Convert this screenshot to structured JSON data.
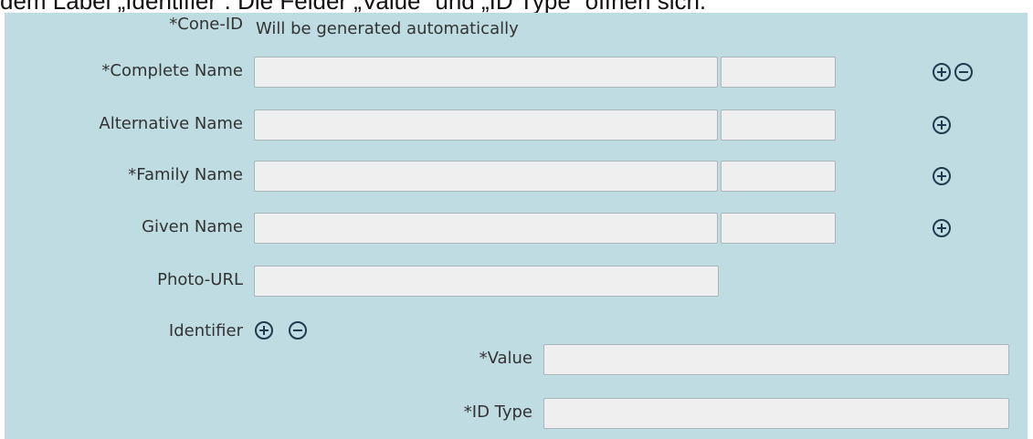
{
  "caption": "dem Label „Identifier“. Die Felder „Value“ und „ID Type“ öffnen sich.",
  "form": {
    "cone_id": {
      "label": "*Cone-ID",
      "value": "Will be generated automatically"
    },
    "complete_name": {
      "label": "*Complete Name",
      "value": "",
      "type_value": ""
    },
    "alternative_name": {
      "label": "Alternative Name",
      "value": "",
      "type_value": ""
    },
    "family_name": {
      "label": "*Family Name",
      "value": "",
      "type_value": ""
    },
    "given_name": {
      "label": "Given Name",
      "value": "",
      "type_value": ""
    },
    "photo_url": {
      "label": "Photo-URL",
      "value": ""
    },
    "identifier": {
      "label": "Identifier",
      "value_label": "*Value",
      "value": "",
      "id_type_label": "*ID Type",
      "id_type": ""
    }
  },
  "icons": {
    "add": "plus-circle-icon",
    "remove": "minus-circle-icon"
  },
  "colors": {
    "panel": "#bedce2",
    "field": "#efefef",
    "icon": "#1f3b4d"
  }
}
